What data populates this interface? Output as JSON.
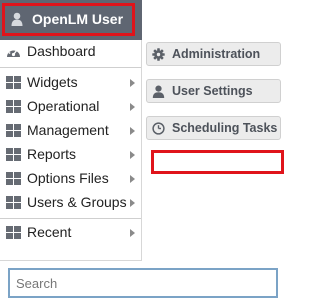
{
  "user_button": {
    "label": "OpenLM User",
    "icon": "user-icon"
  },
  "menu": {
    "items": [
      {
        "label": "Dashboard",
        "icon": "dashboard-icon",
        "submenu": false
      },
      {
        "label": "Widgets",
        "icon": "grid-icon",
        "submenu": true
      },
      {
        "label": "Operational",
        "icon": "grid-icon",
        "submenu": true
      },
      {
        "label": "Management",
        "icon": "grid-icon",
        "submenu": true
      },
      {
        "label": "Reports",
        "icon": "grid-icon",
        "submenu": true
      },
      {
        "label": "Options Files",
        "icon": "grid-icon",
        "submenu": true
      },
      {
        "label": "Users & Groups",
        "icon": "grid-icon",
        "submenu": true
      },
      {
        "label": "Recent",
        "icon": "grid-icon",
        "submenu": true
      }
    ]
  },
  "side_buttons": [
    {
      "label": "Administration",
      "icon": "gear-icon"
    },
    {
      "label": "User Settings",
      "icon": "user-icon"
    },
    {
      "label": "Scheduling Tasks",
      "icon": "clock-icon"
    }
  ],
  "search": {
    "placeholder": "Search",
    "value": ""
  },
  "colors": {
    "user_bar": "#5f6672",
    "highlight": "#e0141b",
    "search_border": "#7ba3c6"
  }
}
